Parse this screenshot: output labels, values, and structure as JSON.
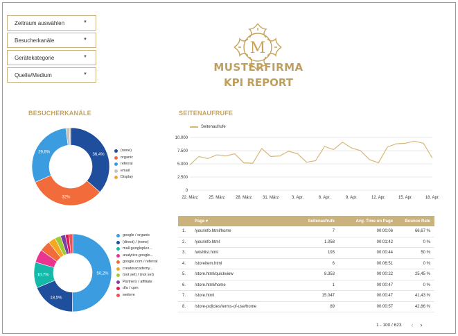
{
  "filters": [
    "Zeitraum auswählen",
    "Besucherkanäle",
    "Gerätekategorie",
    "Quelle/Medium"
  ],
  "brand": {
    "letter": "M",
    "name": "MUSTERFIRMA",
    "subtitle": "KPI REPORT"
  },
  "colors": {
    "gold": "#c7a35a",
    "gold_light": "#d6b877",
    "table_header": "#c9b27c"
  },
  "visitor_channels": {
    "title": "BESUCHERKANÄLE",
    "legend": [
      "(none)",
      "organic",
      "referral",
      "email",
      "Display"
    ],
    "colors": [
      "#1f4e9c",
      "#f26b3a",
      "#3b9de0",
      "#c3c3c3",
      "#f5a623"
    ]
  },
  "source_medium": {
    "legend": [
      "google / organic",
      "(direct) / (none)",
      "mall.googleplex...",
      "analytics.google...",
      "google.com / referral",
      "creatoracademy...",
      "(not set) / (not set)",
      "Partners / affiliate",
      "dfa / cpm",
      "weitere"
    ],
    "colors": [
      "#3b9de0",
      "#1f4e9c",
      "#16b8a9",
      "#e9358f",
      "#f26b3a",
      "#f5a623",
      "#9ccc3a",
      "#7b3fa0",
      "#d81b60",
      "#ef5350"
    ]
  },
  "pageviews": {
    "title": "SEITENAUFRUFE",
    "series_name": "Seitenaufrufe",
    "y_ticks": [
      "10.000",
      "7.500",
      "5.000",
      "2.500",
      "0"
    ],
    "x_ticks": [
      "22. März",
      "25. März",
      "28. März",
      "31. März",
      "3. Apr.",
      "6. Apr.",
      "9. Apr.",
      "12. Apr.",
      "15. Apr.",
      "18. Apr."
    ]
  },
  "table": {
    "headers": {
      "page": "Page ▾",
      "views": "Seitenaufrufe",
      "time": "Avg. Time on Page",
      "bounce": "Bounce Rate"
    },
    "rows": [
      {
        "idx": "1.",
        "page": "/yourinfo.html/home",
        "views": "7",
        "time": "00:00:06",
        "bounce": "66,67 %"
      },
      {
        "idx": "2.",
        "page": "/yourinfo.html",
        "views": "1.058",
        "time": "00:01:42",
        "bounce": "0 %"
      },
      {
        "idx": "3.",
        "page": "/wishlist.html",
        "views": "193",
        "time": "00:00:44",
        "bounce": "50 %"
      },
      {
        "idx": "4.",
        "page": "/storeitem.html",
        "views": "6",
        "time": "00:06:51",
        "bounce": "0 %"
      },
      {
        "idx": "5.",
        "page": "/store.html/quickview",
        "views": "8.353",
        "time": "00:00:22",
        "bounce": "25,45 %"
      },
      {
        "idx": "6.",
        "page": "/store.html/home",
        "views": "1",
        "time": "00:00:47",
        "bounce": "0 %"
      },
      {
        "idx": "7.",
        "page": "/store.html",
        "views": "15.047",
        "time": "00:00:47",
        "bounce": "41,43 %"
      },
      {
        "idx": "8.",
        "page": "/store-policies/terms-of-use/home",
        "views": "89",
        "time": "00:00:57",
        "bounce": "42,86 %"
      }
    ]
  },
  "pager": {
    "range": "1 - 100 / 623"
  },
  "chart_data": [
    {
      "type": "pie",
      "title": "BESUCHERKANÄLE",
      "categories": [
        "(none)",
        "organic",
        "referral",
        "email",
        "Display"
      ],
      "values": [
        36.4,
        32,
        29.6,
        1.5,
        0.5
      ],
      "data_labels": [
        "36,4%",
        "32%",
        "29,6%",
        "",
        ""
      ]
    },
    {
      "type": "pie",
      "categories": [
        "google / organic",
        "(direct) / (none)",
        "mall.googleplex...",
        "analytics.google...",
        "google.com / referral",
        "creatoracademy...",
        "(not set) / (not set)",
        "Partners / affiliate",
        "dfa / cpm",
        "weitere"
      ],
      "values": [
        50.2,
        18.5,
        10.7,
        5.5,
        4.5,
        3,
        2.5,
        2,
        1.5,
        1.6
      ],
      "data_labels": [
        "50,2%",
        "18,5%",
        "10,7%",
        "",
        "",
        "",
        "",
        "",
        "",
        ""
      ]
    },
    {
      "type": "line",
      "title": "SEITENAUFRUFE",
      "series": [
        {
          "name": "Seitenaufrufe",
          "values": [
            4800,
            6400,
            6000,
            6700,
            6500,
            6900,
            5200,
            5100,
            7900,
            6400,
            6500,
            7400,
            6900,
            5300,
            5600,
            8300,
            7700,
            9100,
            8000,
            7500,
            5800,
            5200,
            8200,
            8800,
            8900,
            9300,
            8900,
            6100
          ]
        }
      ],
      "x": [
        "22. März",
        "23. März",
        "24. März",
        "25. März",
        "26. März",
        "27. März",
        "28. März",
        "29. März",
        "30. März",
        "31. März",
        "1. Apr.",
        "2. Apr.",
        "3. Apr.",
        "4. Apr.",
        "5. Apr.",
        "6. Apr.",
        "7. Apr.",
        "8. Apr.",
        "9. Apr.",
        "10. Apr.",
        "11. Apr.",
        "12. Apr.",
        "13. Apr.",
        "14. Apr.",
        "15. Apr.",
        "16. Apr.",
        "17. Apr.",
        "18. Apr."
      ],
      "ylim": [
        0,
        10000
      ],
      "grid": true,
      "legend": "top-left"
    }
  ]
}
